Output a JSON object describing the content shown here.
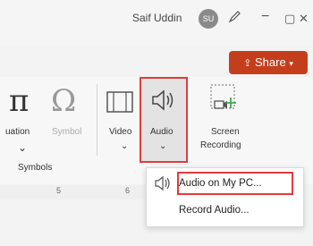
{
  "titlebar": {
    "user_name": "Saif Uddin",
    "avatar_initials": "SU",
    "minimize": "−",
    "restore": "▢",
    "close": "✕"
  },
  "share": {
    "label": "Share",
    "icon": "share-icon"
  },
  "ribbon": {
    "equation_label": "uation",
    "symbol_label": "Symbol",
    "video_label": "Video",
    "audio_label": "Audio",
    "screen_recording_label_line1": "Screen",
    "screen_recording_label_line2": "Recording",
    "group_symbols": "Symbols",
    "pi_glyph": "π",
    "omega_glyph": "Ω"
  },
  "ruler": {
    "mark_5": "5",
    "mark_6": "6"
  },
  "audio_menu": {
    "items": [
      {
        "label": "Audio on My PC..."
      },
      {
        "label": "Record Audio..."
      }
    ]
  },
  "colors": {
    "accent": "#c43e1c",
    "highlight_border": "#e23b3b"
  }
}
